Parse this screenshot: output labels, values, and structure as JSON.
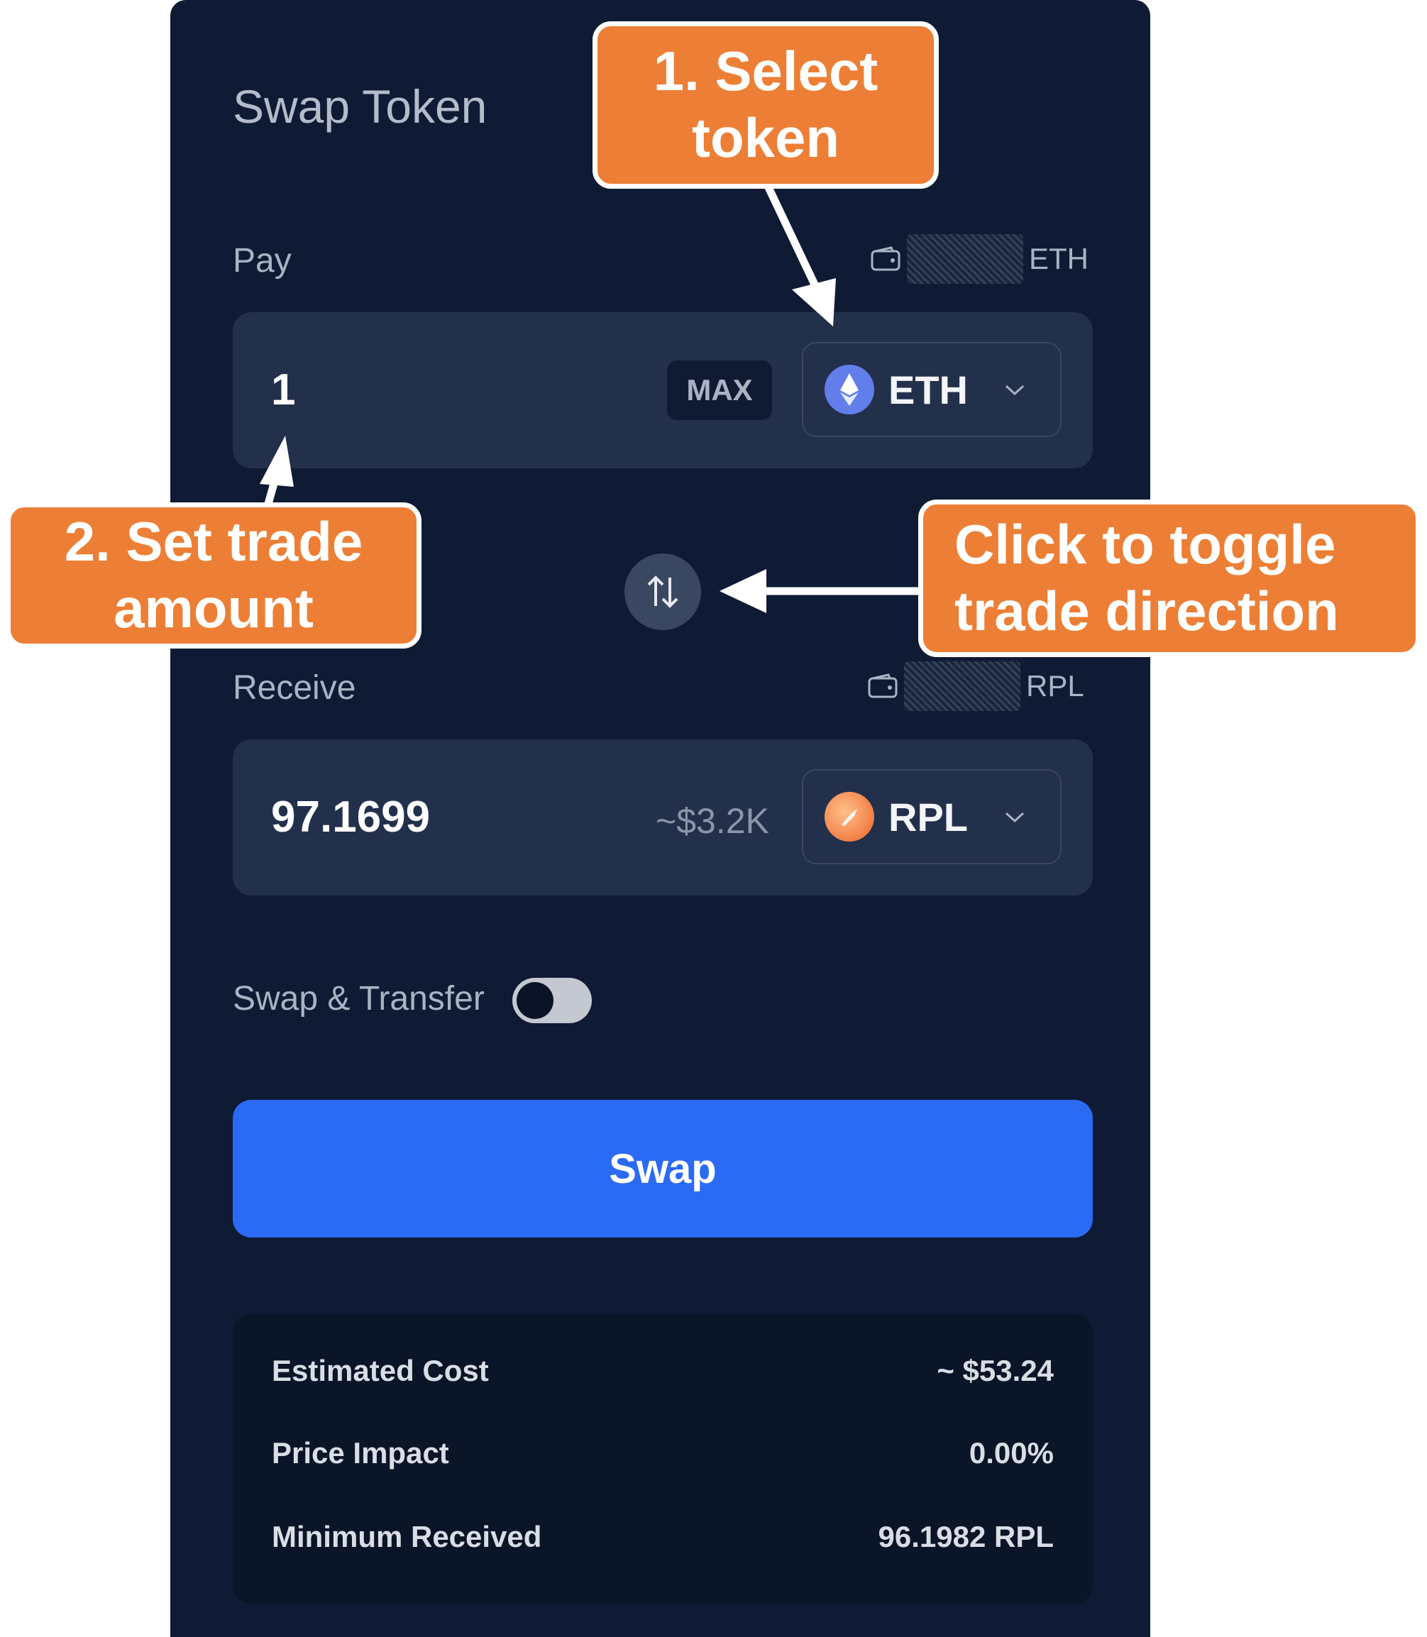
{
  "title": "Swap Token",
  "pay": {
    "label": "Pay",
    "balance_symbol": "ETH",
    "amount": "1",
    "max_label": "MAX",
    "token_symbol": "ETH"
  },
  "receive": {
    "label": "Receive",
    "balance_symbol": "RPL",
    "amount": "97.1699",
    "usd_value": "~$3.2K",
    "token_symbol": "RPL"
  },
  "swap_transfer": {
    "label": "Swap & Transfer",
    "enabled": false
  },
  "swap_button": "Swap",
  "summary": [
    {
      "label": "Estimated Cost",
      "value": "~ $53.24"
    },
    {
      "label": "Price Impact",
      "value": "0.00%"
    },
    {
      "label": "Minimum Received",
      "value": "96.1982 RPL"
    }
  ],
  "annotations": {
    "select_token": "1. Select token",
    "set_amount": "2. Set trade amount",
    "toggle_direction": "Click to toggle trade direction"
  },
  "colors": {
    "panel_bg": "#0f1b35",
    "input_bg": "#22304c",
    "accent": "#2b6af3",
    "callout": "#ec7f35"
  },
  "icons": [
    "wallet-icon",
    "eth-icon",
    "rpl-icon",
    "chevron-down-icon",
    "swap-direction-icon"
  ]
}
